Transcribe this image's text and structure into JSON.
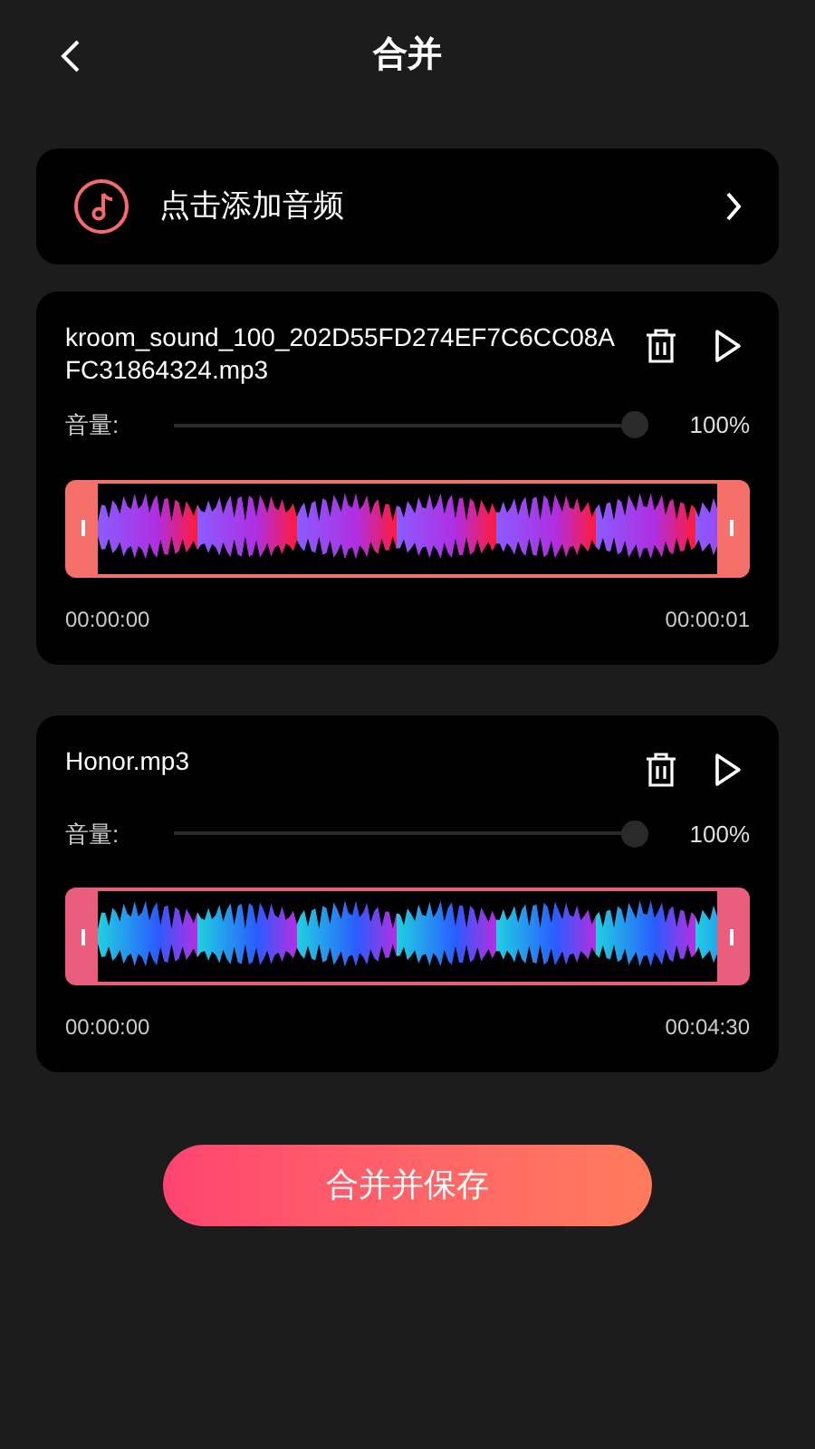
{
  "header": {
    "title": "合并"
  },
  "add_audio": {
    "label": "点击添加音频"
  },
  "tracks": [
    {
      "name": "kroom_sound_100_202D55FD274EF7C6CC08AFC31864324.mp3",
      "volume_label": "音量:",
      "level": 1,
      "reading": "100%",
      "color": "#f5706a",
      "start": "00:00:00",
      "end": "00:00:01"
    },
    {
      "name": "Honor.mp3",
      "volume_label": "音量:",
      "level": 1,
      "reading": "100%",
      "color": "#ea5d7c",
      "start": "00:00:00",
      "end": "00:04:30"
    }
  ],
  "save_button": {
    "label": "合并并保存"
  }
}
